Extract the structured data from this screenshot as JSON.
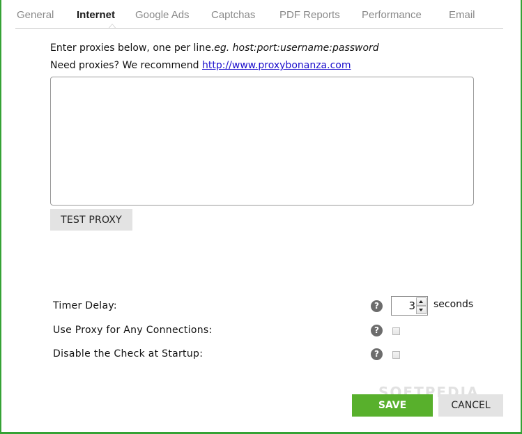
{
  "tabs": [
    {
      "label": "General",
      "active": false
    },
    {
      "label": "Internet",
      "active": true
    },
    {
      "label": "Google Ads",
      "active": false
    },
    {
      "label": "Captchas",
      "active": false
    },
    {
      "label": "PDF Reports",
      "active": false
    },
    {
      "label": "Performance",
      "active": false
    },
    {
      "label": "Email",
      "active": false
    }
  ],
  "instructions": {
    "line1_text": "Enter proxies below, one per line.",
    "line1_example": "eg. host:port:username:password",
    "line2_text": "Need proxies? We recommend ",
    "line2_link": "http://www.proxybonanza.com"
  },
  "proxy_input": {
    "value": ""
  },
  "buttons": {
    "test_proxy": "TEST PROXY",
    "save": "SAVE",
    "cancel": "CANCEL"
  },
  "settings": {
    "timer_delay": {
      "label": "Timer Delay:",
      "value": "3",
      "unit": "seconds"
    },
    "use_proxy": {
      "label": "Use Proxy for Any Connections:",
      "checked": false
    },
    "disable_check": {
      "label": "Disable the Check at Startup:",
      "checked": false
    },
    "help_glyph": "?"
  },
  "watermark": "SOFTPEDIA",
  "colors": {
    "frame_green": "#35a235",
    "save_green": "#58b02c",
    "link_blue": "#1a0dcc",
    "button_gray": "#e3e3e3",
    "help_gray": "#6c6c6c"
  }
}
